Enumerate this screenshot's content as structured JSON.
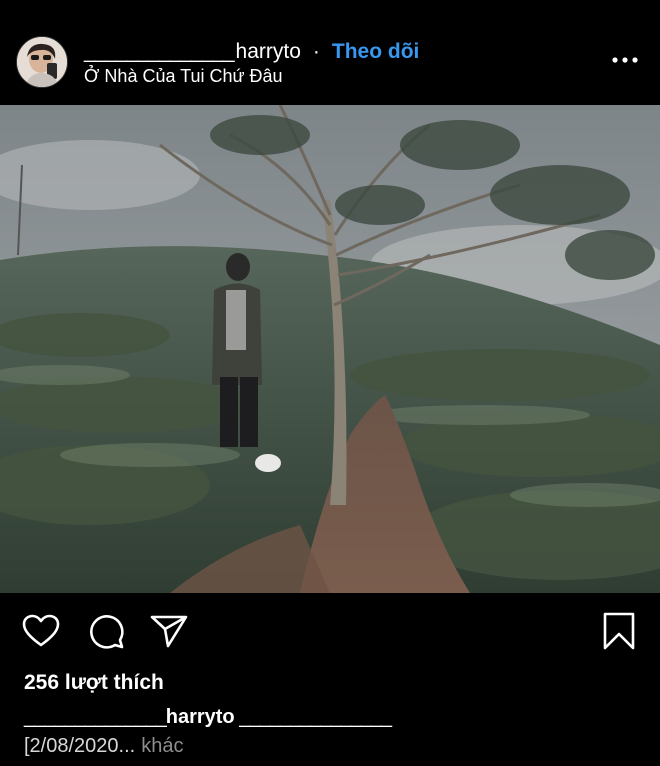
{
  "header": {
    "username_prefix": "______________",
    "username": "harryto",
    "separator": "·",
    "follow_label": "Theo dõi",
    "location": "Ở Nhà Của Tui Chứ Đâu"
  },
  "post": {
    "likes": "256 lượt thích",
    "caption_user_prefix": "______________",
    "caption_user": "harryto",
    "caption_text": " _______________",
    "date": "[2/08/2020...",
    "more_label": "khác"
  },
  "icons": {
    "more": "more-horizontal-icon",
    "like": "heart-icon",
    "comment": "comment-icon",
    "share": "send-icon",
    "save": "bookmark-icon"
  },
  "colors": {
    "background": "#000000",
    "text": "#ffffff",
    "follow": "#3897f0",
    "muted": "#8e8e8e"
  }
}
